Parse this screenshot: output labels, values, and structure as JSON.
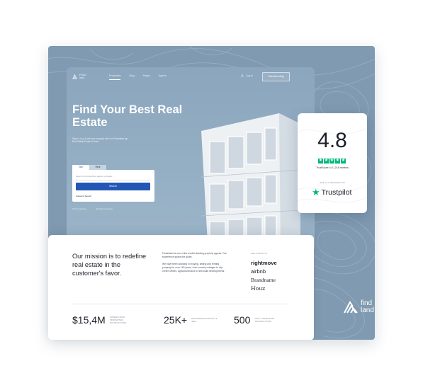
{
  "colors": {
    "accent": "#2357b5",
    "background_blue": "#7f9ab1",
    "trustpilot_green": "#00b67a"
  },
  "nav": {
    "logo_text": "Findor land",
    "links": [
      "Properties",
      "Blog",
      "Pages",
      "Agents"
    ],
    "login": "Log In",
    "listing_button": "Submit Listing"
  },
  "hero": {
    "title": "Find Your Best Real Estate",
    "subtitle": "Sign in, buy & sell your property with our Findorland top Real Estate Dealer Center.",
    "search": {
      "tabs": [
        "Sell",
        "Rent"
      ],
      "placeholder": "Search for properties, agents, pincode...",
      "button": "Search",
      "advanced": "Advance Search"
    },
    "links": [
      "Find properties",
      "Rental properties"
    ]
  },
  "mission": {
    "title": "Our mission is to redefine real estate in the customer's favor.",
    "paragraphs": [
      "Finderland is one of the world's leading property agents. Our experience spans the globe.",
      "We have been advising on buying, selling and renting property for over 160 years, from country cottages to city-centre offices, agricultural land to new-build developments."
    ],
    "featured_label": "FEATURED IN",
    "brands": [
      "rightmove",
      "airbnb",
      "Brandname",
      "Houz"
    ]
  },
  "stats": [
    {
      "value": "$15,4M",
      "label": "OWNED FROM PROPERTIES TRANSACTIONS"
    },
    {
      "value": "25K+",
      "label": "PROPERTIES FOR BUY & SELL"
    },
    {
      "value": "500",
      "label": "DAILY COMPLETED TRANSACTIONS"
    }
  ],
  "trustpilot": {
    "rating": "4.8",
    "stars": 5,
    "score_text": "TrustScore 4.8 | 218 reviews",
    "see_all": "SEE ALL REVIEWS ON",
    "brand": "Trustpilot"
  },
  "corner_logo": "find land"
}
